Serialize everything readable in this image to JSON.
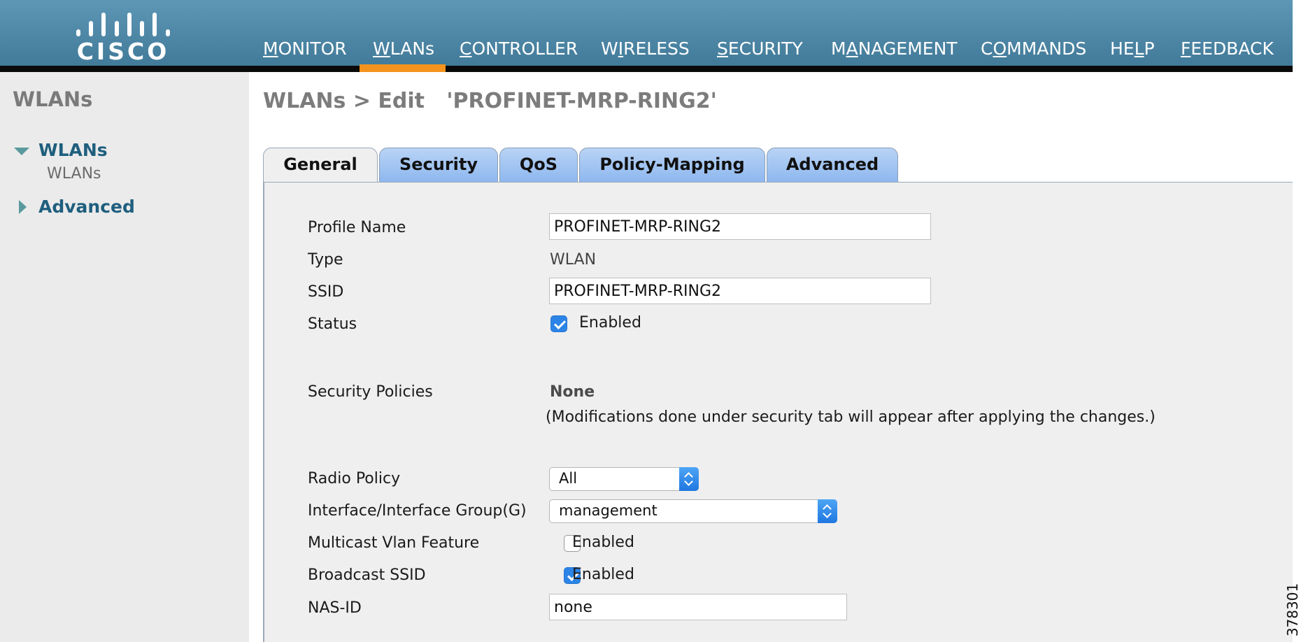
{
  "logo": {
    "text": "CISCO"
  },
  "nav": {
    "items": [
      {
        "pre": "",
        "key": "M",
        "post": "ONITOR"
      },
      {
        "pre": "",
        "key": "W",
        "post": "LANs"
      },
      {
        "pre": "",
        "key": "C",
        "post": "ONTROLLER"
      },
      {
        "pre": "W",
        "key": "I",
        "post": "RELESS"
      },
      {
        "pre": "",
        "key": "S",
        "post": "ECURITY"
      },
      {
        "pre": "M",
        "key": "A",
        "post": "NAGEMENT"
      },
      {
        "pre": "C",
        "key": "O",
        "post": "MMANDS"
      },
      {
        "pre": "HE",
        "key": "L",
        "post": "P"
      },
      {
        "pre": "",
        "key": "F",
        "post": "EEDBACK"
      }
    ],
    "active": "WLANs",
    "active_color": "#f4931e"
  },
  "sidebar": {
    "title": "WLANs",
    "items": [
      {
        "label": "WLANs",
        "expanded": true,
        "icon": "triangle-down-icon",
        "children": [
          "WLANs"
        ]
      },
      {
        "label": "Advanced",
        "expanded": false,
        "icon": "triangle-right-icon"
      }
    ]
  },
  "page": {
    "title": "WLANs > Edit   'PROFINET-MRP-RING2'"
  },
  "tabs": [
    "General",
    "Security",
    "QoS",
    "Policy-Mapping",
    "Advanced"
  ],
  "active_tab": "General",
  "form": {
    "profile_name": {
      "label": "Profile Name",
      "value": "PROFINET-MRP-RING2"
    },
    "type": {
      "label": "Type",
      "value": "WLAN"
    },
    "ssid": {
      "label": "SSID",
      "value": "PROFINET-MRP-RING2"
    },
    "status": {
      "label": "Status",
      "checked": true,
      "text": "Enabled"
    },
    "security_policies": {
      "label": "Security Policies",
      "value": "None",
      "note": "(Modifications done under security tab will appear after applying the changes.)"
    },
    "radio_policy": {
      "label": "Radio Policy",
      "value": "All"
    },
    "interface": {
      "label": "Interface/Interface Group(G)",
      "value": "management"
    },
    "multicast_vlan": {
      "label": "Multicast Vlan Feature",
      "checked": false,
      "text": "Enabled"
    },
    "broadcast_ssid": {
      "label": "Broadcast SSID",
      "checked": true,
      "text": "Enabled"
    },
    "nas_id": {
      "label": "NAS-ID",
      "value": "none"
    }
  },
  "figure_id": "378301",
  "colors": {
    "header": "#4a84a4",
    "sidebar_link": "#1f5f7e",
    "checkbox": "#2c84e6"
  }
}
